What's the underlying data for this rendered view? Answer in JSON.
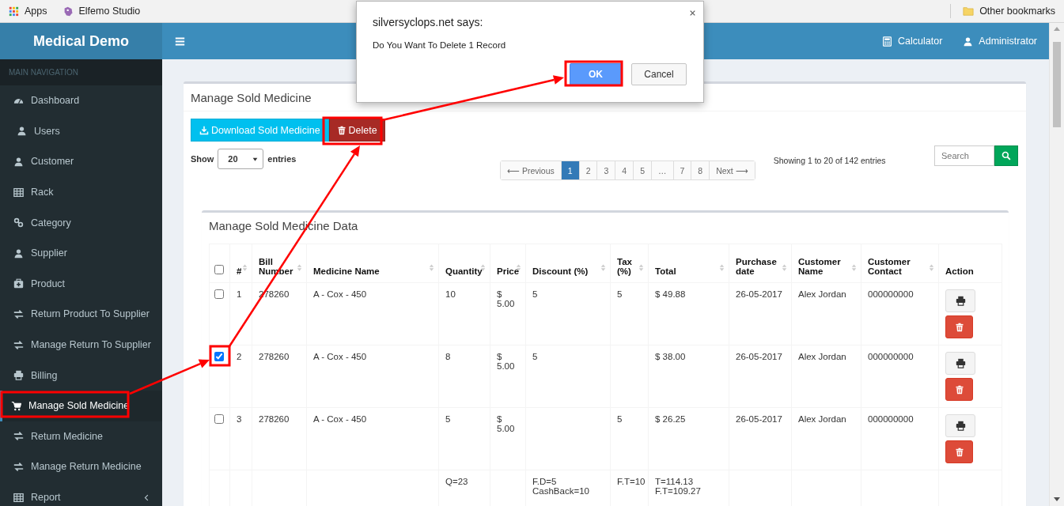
{
  "bookmarks_bar": {
    "items": [
      {
        "label": "Apps",
        "kind": "apps"
      },
      {
        "label": "Elfemo Studio",
        "kind": "site"
      }
    ],
    "other": "Other bookmarks"
  },
  "header": {
    "logo": "Medical Demo",
    "links": [
      {
        "label": "Calculator",
        "kind": "calculator"
      },
      {
        "label": "Administrator",
        "kind": "user"
      }
    ]
  },
  "sidebar": {
    "heading": "MAIN NAVIGATION",
    "items": [
      {
        "label": "Dashboard",
        "kind": "dashboard",
        "selected": false,
        "submenu": false
      },
      {
        "label": "Users",
        "kind": "user",
        "selected": false,
        "submenu": false
      },
      {
        "label": "Customer",
        "kind": "user",
        "selected": false,
        "submenu": false
      },
      {
        "label": "Rack",
        "kind": "table",
        "selected": false,
        "submenu": false
      },
      {
        "label": "Category",
        "kind": "link",
        "selected": false,
        "submenu": false
      },
      {
        "label": "Supplier",
        "kind": "user",
        "selected": false,
        "submenu": false
      },
      {
        "label": "Product",
        "kind": "medkit",
        "selected": false,
        "submenu": false
      },
      {
        "label": "Return Product To Supplier",
        "kind": "exchange",
        "selected": false,
        "submenu": false
      },
      {
        "label": "Manage Return To Supplier",
        "kind": "exchange",
        "selected": false,
        "submenu": false
      },
      {
        "label": "Billing",
        "kind": "print",
        "selected": false,
        "submenu": false
      },
      {
        "label": "Manage Sold Medicine",
        "kind": "cart",
        "selected": true,
        "submenu": false
      },
      {
        "label": "Return Medicine",
        "kind": "exchange",
        "selected": false,
        "submenu": false
      },
      {
        "label": "Manage Return Medicine",
        "kind": "exchange",
        "selected": false,
        "submenu": false
      },
      {
        "label": "Report",
        "kind": "table",
        "selected": false,
        "submenu": true
      }
    ]
  },
  "panel": {
    "title": "Manage Sold Medicine",
    "buttons": [
      {
        "label": "Download Sold Medicine",
        "kind": "download"
      },
      {
        "label": "Delete",
        "kind": "delete"
      }
    ],
    "length": {
      "before": "Show",
      "value": "20",
      "after": "entries"
    },
    "pagination": [
      {
        "label": "⟵ Previous",
        "selected": false
      },
      {
        "label": "1",
        "selected": true
      },
      {
        "label": "2",
        "selected": false
      },
      {
        "label": "3",
        "selected": false
      },
      {
        "label": "4",
        "selected": false
      },
      {
        "label": "5",
        "selected": false
      },
      {
        "label": "…",
        "selected": false
      },
      {
        "label": "7",
        "selected": false
      },
      {
        "label": "8",
        "selected": false
      },
      {
        "label": "Next ⟶",
        "selected": false
      }
    ],
    "info": "Showing 1 to 20 of 142 entries",
    "search": {
      "placeholder": "Search"
    }
  },
  "data_box": {
    "title": "Manage Sold Medicine Data",
    "table": {
      "select_all": false,
      "columns": [
        {
          "label": "#",
          "sortable": true
        },
        {
          "label": "Bill Number",
          "sortable": true
        },
        {
          "label": "Medicine Name",
          "sortable": true
        },
        {
          "label": "Quantity",
          "sortable": true
        },
        {
          "label": "Price",
          "sortable": true
        },
        {
          "label": "Discount (%)",
          "sortable": true
        },
        {
          "label": "Tax (%)",
          "sortable": true
        },
        {
          "label": "Total",
          "sortable": true
        },
        {
          "label": "Purchase date",
          "sortable": true
        },
        {
          "label": "Customer Name",
          "sortable": true
        },
        {
          "label": "Customer Contact",
          "sortable": true
        },
        {
          "label": "Action",
          "sortable": false
        }
      ],
      "rows": [
        {
          "checked": false,
          "cells": [
            "1",
            "278260",
            "A - Cox - 450",
            "10",
            "$ 5.00",
            "5",
            "5",
            "$ 49.88",
            "26-05-2017",
            "Alex Jordan",
            "000000000"
          ]
        },
        {
          "checked": true,
          "cells": [
            "2",
            "278260",
            "A - Cox - 450",
            "8",
            "$ 5.00",
            "5",
            "",
            "$ 38.00",
            "26-05-2017",
            "Alex Jordan",
            "000000000"
          ]
        },
        {
          "checked": false,
          "cells": [
            "3",
            "278260",
            "A - Cox - 450",
            "5",
            "$ 5.00",
            "",
            "5",
            "$ 26.25",
            "26-05-2017",
            "Alex Jordan",
            "000000000"
          ]
        }
      ],
      "totals": {
        "quantity": [
          "Q=23"
        ],
        "discount": [
          "F.D=5",
          "CashBack=10"
        ],
        "tax": [
          "F.T=10"
        ],
        "total": [
          "T=114.13",
          "F.T=109.27"
        ]
      }
    }
  },
  "dialog": {
    "title": "silversyclops.net says:",
    "message": "Do You Want To Delete 1 Record",
    "buttons": [
      {
        "label": "OK",
        "kind": "primary"
      },
      {
        "label": "Cancel",
        "kind": "default"
      }
    ]
  }
}
